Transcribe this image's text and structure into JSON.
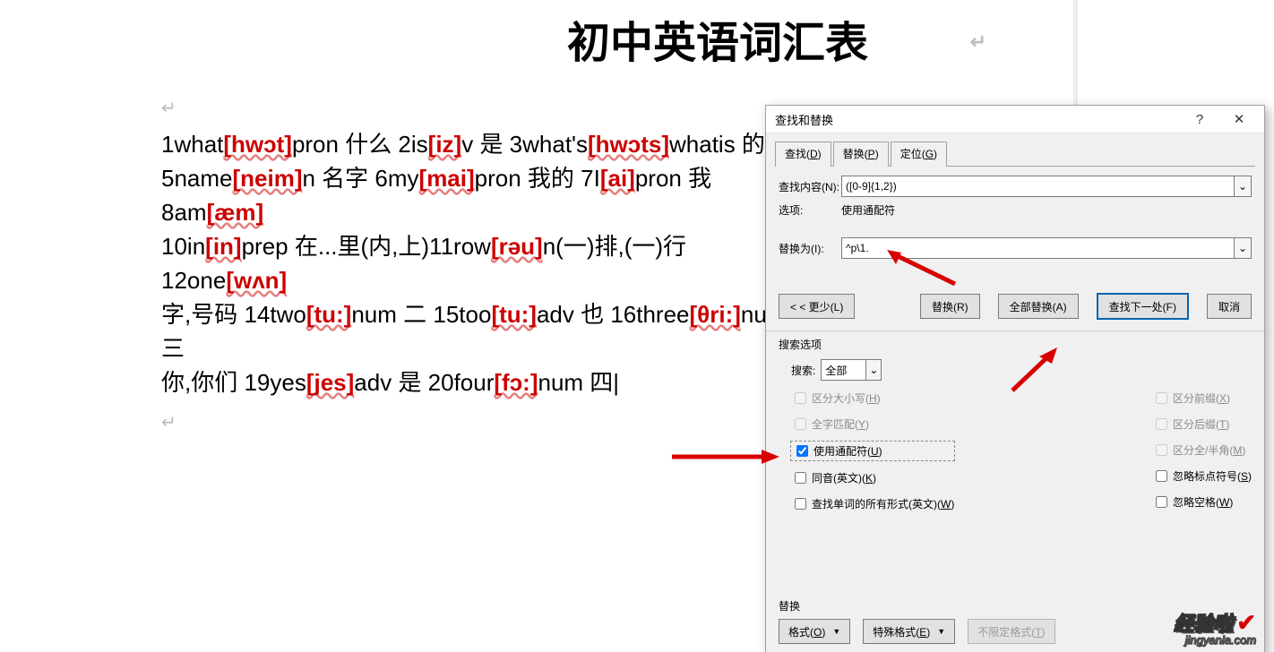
{
  "doc": {
    "title": "初中英语词汇表",
    "lines": [
      {
        "segments": [
          {
            "t": "1what",
            "c": "num"
          },
          {
            "t": "[hwɔt]",
            "c": "phon"
          },
          {
            "t": "pron  什么  2is",
            "c": ""
          },
          {
            "t": "[iz]",
            "c": "phon"
          },
          {
            "t": "v  是  3what's",
            "c": ""
          },
          {
            "t": "[hwɔts]",
            "c": "phon"
          },
          {
            "t": "whatis  的缩",
            "c": ""
          }
        ]
      },
      {
        "segments": [
          {
            "t": "5name",
            "c": ""
          },
          {
            "t": "[neim]",
            "c": "phon"
          },
          {
            "t": "n 名字 6my",
            "c": ""
          },
          {
            "t": "[mai]",
            "c": "phon"
          },
          {
            "t": "pron 我的 7I",
            "c": ""
          },
          {
            "t": "[ai]",
            "c": "phon"
          },
          {
            "t": "pron 我 8am",
            "c": ""
          },
          {
            "t": "[æm]",
            "c": "phon"
          }
        ]
      },
      {
        "segments": [
          {
            "t": "10in",
            "c": ""
          },
          {
            "t": "[in]",
            "c": "phon"
          },
          {
            "t": "prep 在...里(内,上)11row",
            "c": ""
          },
          {
            "t": "[rəu]",
            "c": "phon"
          },
          {
            "t": "n(一)排,(一)行 12one",
            "c": ""
          },
          {
            "t": "[wʌn]",
            "c": "phon"
          }
        ]
      },
      {
        "segments": [
          {
            "t": "字,号码 14two",
            "c": ""
          },
          {
            "t": "[tu:]",
            "c": "phon"
          },
          {
            "t": "num 二 15too",
            "c": ""
          },
          {
            "t": "[tu:]",
            "c": "phon"
          },
          {
            "t": "adv 也 16three",
            "c": ""
          },
          {
            "t": "[θri:]",
            "c": "phon"
          },
          {
            "t": "num 三",
            "c": ""
          }
        ]
      },
      {
        "segments": [
          {
            "t": "你,你们 19yes",
            "c": ""
          },
          {
            "t": "[jes]",
            "c": "phon"
          },
          {
            "t": "adv 是 20four",
            "c": ""
          },
          {
            "t": "[fɔ:]",
            "c": "phon"
          },
          {
            "t": "num 四",
            "c": ""
          }
        ]
      }
    ]
  },
  "dialog": {
    "title": "查找和替换",
    "tabs": {
      "find": "查找(D)",
      "replace": "替换(P)",
      "goto": "定位(G)"
    },
    "find_label": "查找内容(N):",
    "find_value": "([0-9]{1,2})",
    "options_label": "选项:",
    "options_value": "使用通配符",
    "replace_label": "替换为(I):",
    "replace_value": "^p\\1.",
    "buttons": {
      "less": "< < 更少(L)",
      "replace": "替换(R)",
      "replace_all": "全部替换(A)",
      "find_next": "查找下一处(F)",
      "cancel": "取消"
    },
    "search_options_label": "搜索选项",
    "search_label": "搜索:",
    "search_value": "全部",
    "checks_left": {
      "match_case": "区分大小写(H)",
      "whole_word": "全字匹配(Y)",
      "use_wildcards": "使用通配符(U)",
      "sounds_like": "同音(英文)(K)",
      "all_forms": "查找单词的所有形式(英文)(W)"
    },
    "checks_right": {
      "prefix": "区分前缀(X)",
      "suffix": "区分后缀(T)",
      "width": "区分全/半角(M)",
      "ignore_punct": "忽略标点符号(S)",
      "ignore_space": "忽略空格(W)"
    },
    "replace_section": "替换",
    "format_btn": "格式(O)",
    "special_btn": "特殊格式(E)",
    "noformat_btn": "不限定格式(T)"
  },
  "watermark": {
    "cn": "经验啦",
    "url": "jingyanla.com"
  }
}
